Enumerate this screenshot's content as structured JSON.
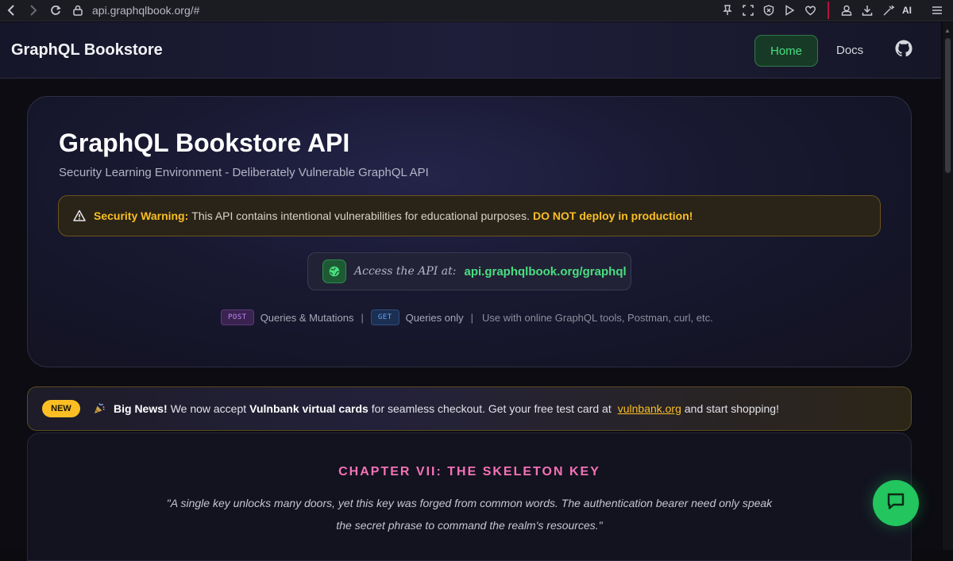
{
  "browser": {
    "url": "api.graphqlbook.org/#",
    "ai_label": "AI"
  },
  "header": {
    "brand": "GraphQL Bookstore",
    "nav": {
      "home": "Home",
      "docs": "Docs"
    }
  },
  "hero": {
    "title": "GraphQL Bookstore API",
    "subtitle": "Security Learning Environment - Deliberately Vulnerable GraphQL API",
    "warning": {
      "label": "Security Warning:",
      "text": "This API contains intentional vulnerabilities for educational purposes.",
      "emphasis": "DO NOT deploy in production!"
    },
    "access": {
      "label": "Access the API at:",
      "url": "api.graphqlbook.org/graphql"
    },
    "methods": {
      "post_badge": "POST",
      "post_text": "Queries & Mutations",
      "sep1": "|",
      "get_badge": "GET",
      "get_text": "Queries only",
      "sep2": "|",
      "note": "Use with online GraphQL tools, Postman, curl, etc."
    }
  },
  "news": {
    "badge": "NEW",
    "lead": "Big News!",
    "text1": "We now accept",
    "highlight": "Vulnbank virtual cards",
    "text2": "for seamless checkout. Get your free test card at",
    "link": "vulnbank.org",
    "text3": "and start shopping!"
  },
  "story": {
    "chapter": "CHAPTER VII: THE SKELETON KEY",
    "quote": "\"A single key unlocks many doors, yet this key was forged from common words. The authentication bearer need only speak the secret phrase to command the realm's resources.\""
  },
  "colors": {
    "accent_green": "#4ade80",
    "warning_yellow": "#fbbf24",
    "chapter_pink": "#f472b6"
  }
}
